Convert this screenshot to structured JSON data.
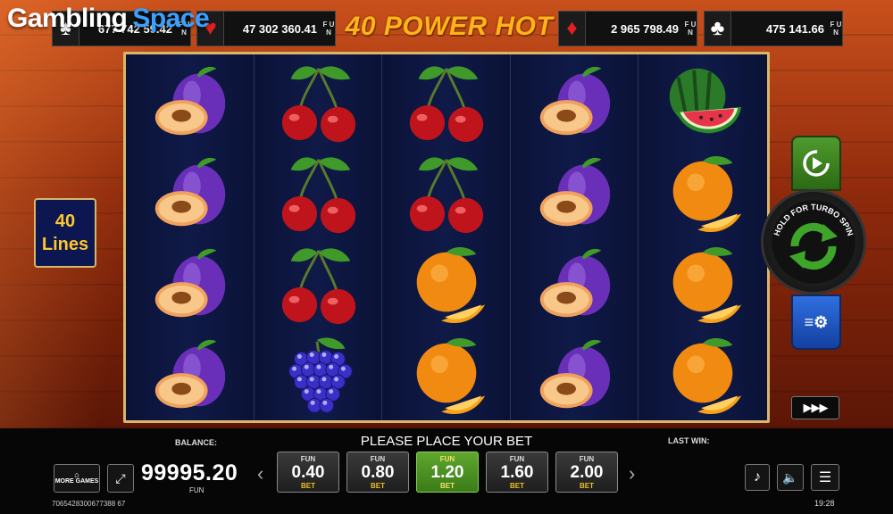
{
  "logo": {
    "part1": "Gambling",
    "part2": "Space"
  },
  "game_title": "40 POWER HOT",
  "jackpots": [
    {
      "suit_icon": "spade-icon",
      "symbol": "♠",
      "value": "677 742 59.42",
      "fun": "F U N"
    },
    {
      "suit_icon": "heart-icon",
      "symbol": "♥",
      "value": "47 302 360.41",
      "fun": "F U N"
    },
    {
      "suit_icon": "diamond-icon",
      "symbol": "♦",
      "value": "2 965 798.49",
      "fun": "F U N"
    },
    {
      "suit_icon": "club-icon",
      "symbol": "♣",
      "value": "475 141.66",
      "fun": "F U N"
    }
  ],
  "lines": {
    "count": "40",
    "label": "Lines"
  },
  "reels": [
    [
      "plum",
      "plum",
      "plum",
      "plum"
    ],
    [
      "cherry",
      "cherry",
      "cherry",
      "grapes"
    ],
    [
      "cherry",
      "cherry",
      "orange",
      "orange"
    ],
    [
      "plum",
      "plum",
      "plum",
      "plum"
    ],
    [
      "watermelon",
      "orange",
      "orange",
      "orange"
    ]
  ],
  "controls": {
    "turbo_label": "HOLD FOR TURBO SPIN",
    "fast_label": "▶▶▶"
  },
  "bottom": {
    "balance_label": "BALANCE:",
    "balance_value": "99995.20",
    "balance_unit": "FUN",
    "message": "PLEASE PLACE YOUR BET",
    "last_win_label": "LAST WIN:",
    "more_games": "MORE GAMES",
    "bets": [
      {
        "fun": "FUN",
        "value": "0.40",
        "bet": "BET",
        "selected": false
      },
      {
        "fun": "FUN",
        "value": "0.80",
        "bet": "BET",
        "selected": false
      },
      {
        "fun": "FUN",
        "value": "1.20",
        "bet": "BET",
        "selected": true
      },
      {
        "fun": "FUN",
        "value": "1.60",
        "bet": "BET",
        "selected": false
      },
      {
        "fun": "FUN",
        "value": "2.00",
        "bet": "BET",
        "selected": false
      }
    ],
    "session_id": "7065428300677388 67",
    "time": "19:28"
  },
  "colors": {
    "accent_gold": "#ffb21a",
    "reel_bg": "#08102e",
    "spin_green": "#3fa52a",
    "settings_blue": "#2f6fe0"
  }
}
